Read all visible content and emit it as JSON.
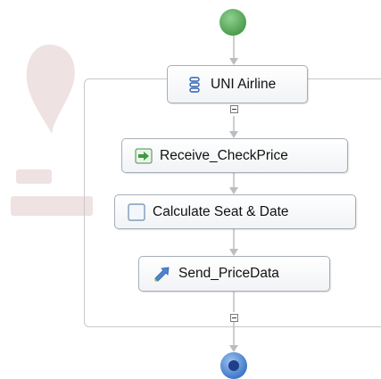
{
  "scope_label": "UNI Airline",
  "activities": [
    {
      "label": "Receive_CheckPrice",
      "icon": "receive-arrow-icon"
    },
    {
      "label": "Calculate Seat & Date",
      "icon": "empty-square-icon"
    },
    {
      "label": "Send_PriceData",
      "icon": "send-arrow-icon"
    }
  ],
  "colors": {
    "start": "#5fae5f",
    "end": "#3f79c9",
    "connector": "#bdbdbd",
    "scope_border": "#c9c9c9"
  }
}
